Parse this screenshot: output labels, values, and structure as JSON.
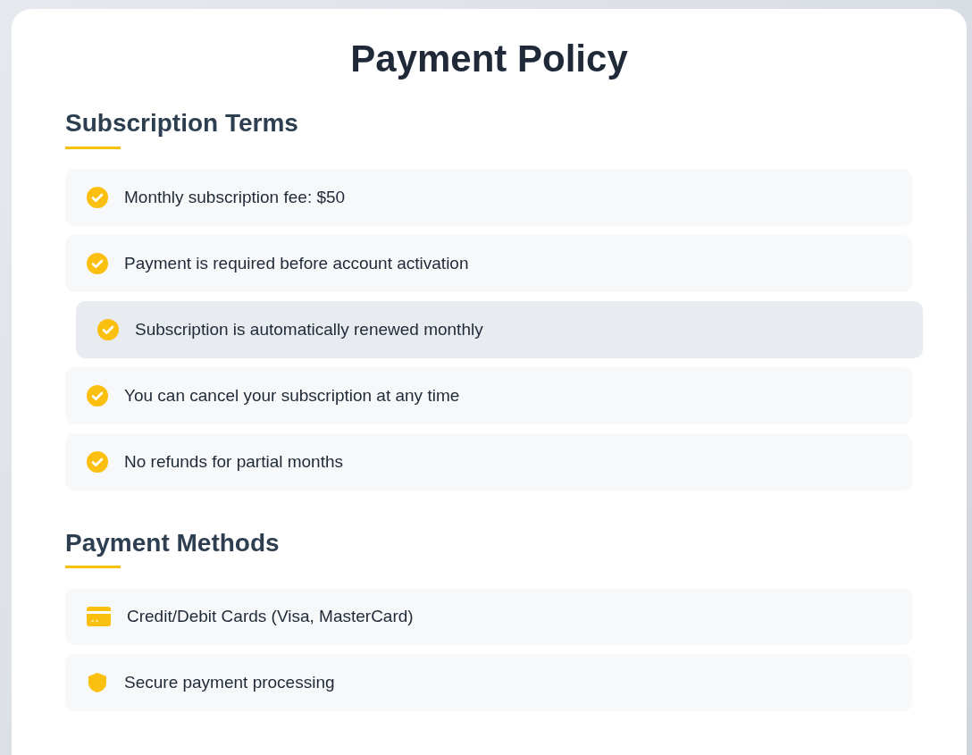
{
  "title": "Payment Policy",
  "sections": [
    {
      "heading": "Subscription Terms",
      "items": [
        {
          "kind": "check",
          "text": "Monthly subscription fee: $50",
          "highlighted": false
        },
        {
          "kind": "check",
          "text": "Payment is required before account activation",
          "highlighted": false
        },
        {
          "kind": "check",
          "text": "Subscription is automatically renewed monthly",
          "highlighted": true
        },
        {
          "kind": "check",
          "text": "You can cancel your subscription at any time",
          "highlighted": false
        },
        {
          "kind": "check",
          "text": "No refunds for partial months",
          "highlighted": false
        }
      ]
    },
    {
      "heading": "Payment Methods",
      "items": [
        {
          "kind": "card",
          "text": "Credit/Debit Cards (Visa, MasterCard)",
          "highlighted": false
        },
        {
          "kind": "shield",
          "text": "Secure payment processing",
          "highlighted": false
        }
      ]
    }
  ]
}
